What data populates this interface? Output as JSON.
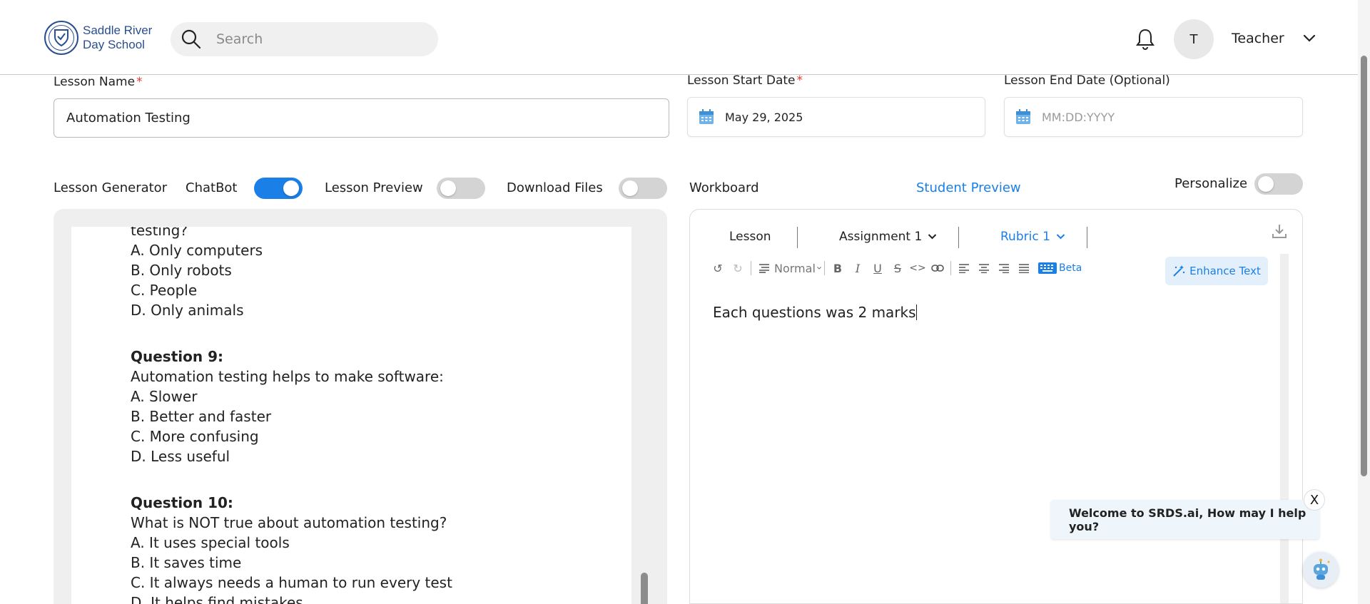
{
  "header": {
    "logo_line1": "Saddle River",
    "logo_line2": "Day School",
    "search_placeholder": "Search",
    "avatar_initial": "T",
    "user_name": "Teacher"
  },
  "form": {
    "lesson_name_label": "Lesson Name",
    "lesson_name_value": "Automation Testing",
    "start_date_label": "Lesson Start Date",
    "start_date_value": "May 29, 2025",
    "end_date_label": "Lesson End Date (Optional)",
    "end_date_placeholder": "MM:DD:YYYY",
    "required_mark": "*"
  },
  "tabs": {
    "lesson_generator": "Lesson Generator",
    "chatbot": "ChatBot",
    "chatbot_on": true,
    "lesson_preview": "Lesson Preview",
    "lesson_preview_on": false,
    "download_files": "Download Files",
    "download_files_on": false,
    "workboard": "Workboard",
    "student_preview": "Student Preview",
    "personalize": "Personalize",
    "personalize_on": false
  },
  "lesson_content": {
    "lines": [
      {
        "text": "testing?",
        "bold": false
      },
      {
        "text": "A. Only computers",
        "bold": false
      },
      {
        "text": "B. Only robots",
        "bold": false
      },
      {
        "text": "C. People",
        "bold": false
      },
      {
        "text": "D. Only animals",
        "bold": false
      },
      {
        "text": "Question 9:",
        "bold": true
      },
      {
        "text": "Automation testing helps to make software:",
        "bold": false
      },
      {
        "text": "A. Slower",
        "bold": false
      },
      {
        "text": "B. Better and faster",
        "bold": false
      },
      {
        "text": "C. More confusing",
        "bold": false
      },
      {
        "text": "D. Less useful",
        "bold": false
      },
      {
        "text": "Question 10:",
        "bold": true
      },
      {
        "text": "What is NOT true about automation testing?",
        "bold": false
      },
      {
        "text": "A. It uses special tools",
        "bold": false
      },
      {
        "text": "B. It saves time",
        "bold": false
      },
      {
        "text": "C. It always needs a human to run every test",
        "bold": false
      },
      {
        "text": "D. It helps find mistakes",
        "bold": false
      }
    ]
  },
  "workboard": {
    "tabs": [
      {
        "label": "Lesson",
        "active": false,
        "dropdown": false
      },
      {
        "label": "Assignment 1",
        "active": false,
        "dropdown": true
      },
      {
        "label": "Rubric 1",
        "active": true,
        "dropdown": true
      }
    ],
    "format_select": "Normal",
    "beta_label": "Beta",
    "enhance_label": "Enhance Text",
    "editor_text": "Each questions was 2 marks"
  },
  "chat": {
    "message": "Welcome to SRDS.ai, How may I help you?",
    "close_label": "X"
  }
}
